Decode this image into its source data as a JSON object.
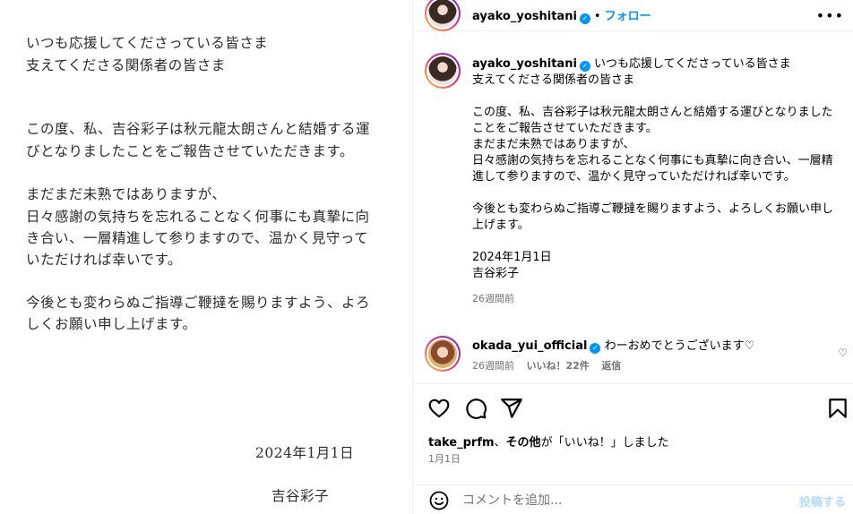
{
  "image": {
    "lines": [
      "いつも応援してくださっている皆さま",
      "支えてくださる関係者の皆さま",
      "この度、私、吉谷彩子は秋元龍太朗さんと結婚する運",
      "びとなりましたことをご報告させていただきます。",
      "まだまだ未熟ではありますが、",
      "日々感謝の気持ちを忘れることなく何事にも真摯に向",
      "き合い、一層精進して参りますので、温かく見守って",
      "いただければ幸いです。",
      "今後とも変わらぬご指導ご鞭撻を賜りますよう、よろ",
      "しくお願い申し上げます。"
    ],
    "date": "2024年1月1日",
    "signature": "吉谷彩子"
  },
  "header": {
    "username": "ayako_yoshitani",
    "separator": "•",
    "follow_label": "フォロー",
    "more_icon": "more-horizontal-icon"
  },
  "caption": {
    "username": "ayako_yoshitani",
    "text_first": "いつも応援してくださっている皆さま\n支えてくださる関係者の皆さま\n\nこの度、私、吉谷彩子は秋元龍太朗さんと結婚する運びとなりましたことをご報告させていただきます。\nまだまだ未熟ではありますが、\n日々感謝の気持ちを忘れることなく何事にも真摯に向き合い、一層精進して参りますので、温かく見守っていただければ幸いです。\n\n今後とも変わらぬご指導ご鞭撻を賜りますよう、よろしくお願い申し上げます。\n\n2024年1月1日\n吉谷彩子",
    "time": "26週間前"
  },
  "comment": {
    "username": "okada_yui_official",
    "text": "わーおめでとうございます♡",
    "time": "26週間前",
    "likes": "いいね！22件",
    "reply": "返信"
  },
  "likes_line": {
    "user": "take_prfm",
    "connector": "、",
    "others": "その他",
    "suffix": "が「いいね！」しました"
  },
  "post_date": "1月1日",
  "comment_box": {
    "placeholder": "コメントを追加...",
    "post_label": "投稿する"
  },
  "colors": {
    "accent": "#0095f6",
    "meta_text": "#737373",
    "post_disabled": "#b3dbff"
  }
}
